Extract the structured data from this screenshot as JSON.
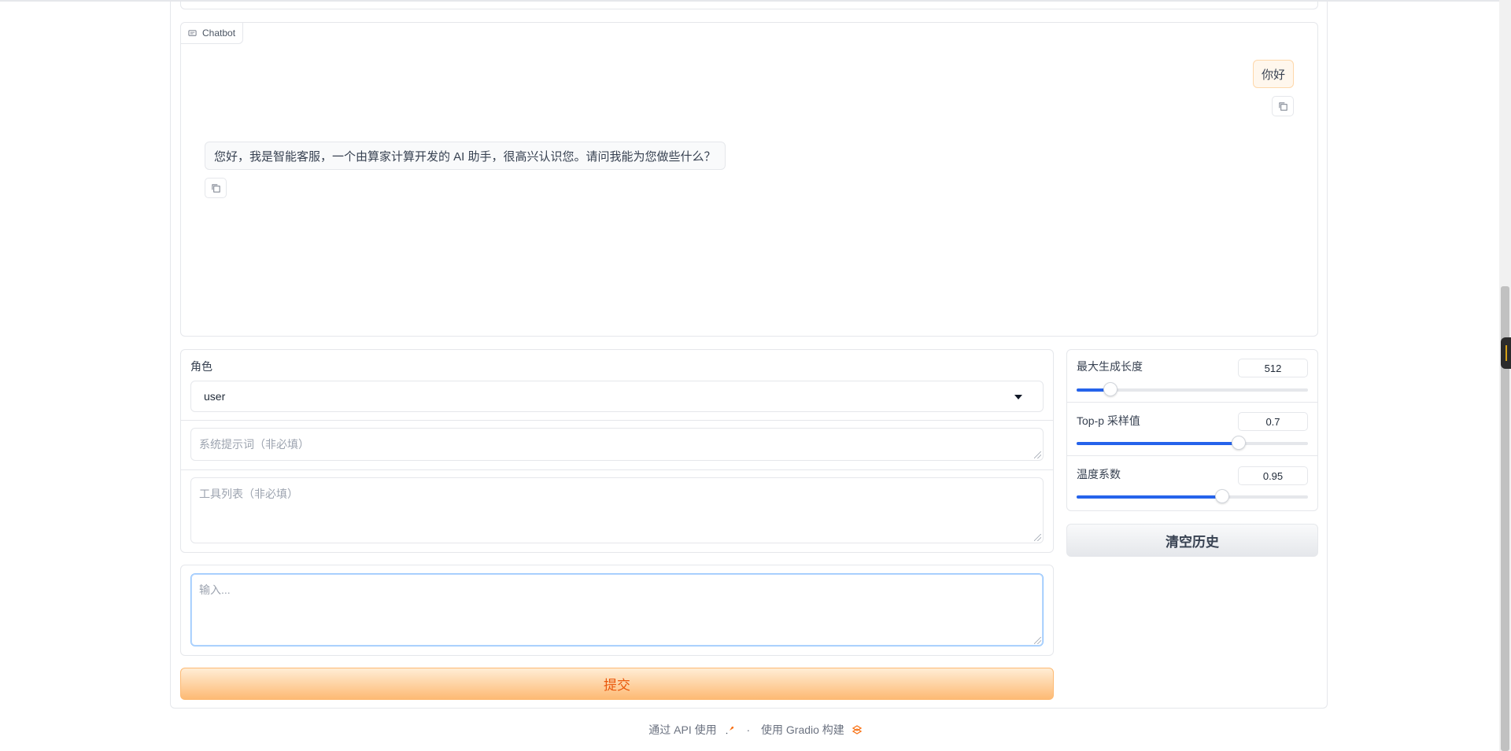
{
  "chatbot": {
    "label": "Chatbot",
    "messages": [
      {
        "role": "user",
        "text": "你好"
      },
      {
        "role": "assistant",
        "text": "您好，我是智能客服，一个由算家计算开发的 AI 助手，很高兴认识您。请问我能为您做些什么？"
      }
    ]
  },
  "form": {
    "role_label": "角色",
    "role_value": "user",
    "system_prompt_placeholder": "系统提示词（非必填）",
    "tools_placeholder": "工具列表（非必填）",
    "input_placeholder": "输入..."
  },
  "submit_label": "提交",
  "sliders": [
    {
      "label": "最大生成长度",
      "value": "512",
      "fraction": 0.145
    },
    {
      "label": "Top-p 采样值",
      "value": "0.7",
      "fraction": 0.7
    },
    {
      "label": "温度系数",
      "value": "0.95",
      "fraction": 0.63
    }
  ],
  "clear_label": "清空历史",
  "footer": {
    "api_text": "通过 API 使用",
    "separator": "·",
    "built_text": "使用 Gradio 构建"
  },
  "colors": {
    "accent": "#2563eb",
    "primary_orange": "#fdba74"
  }
}
